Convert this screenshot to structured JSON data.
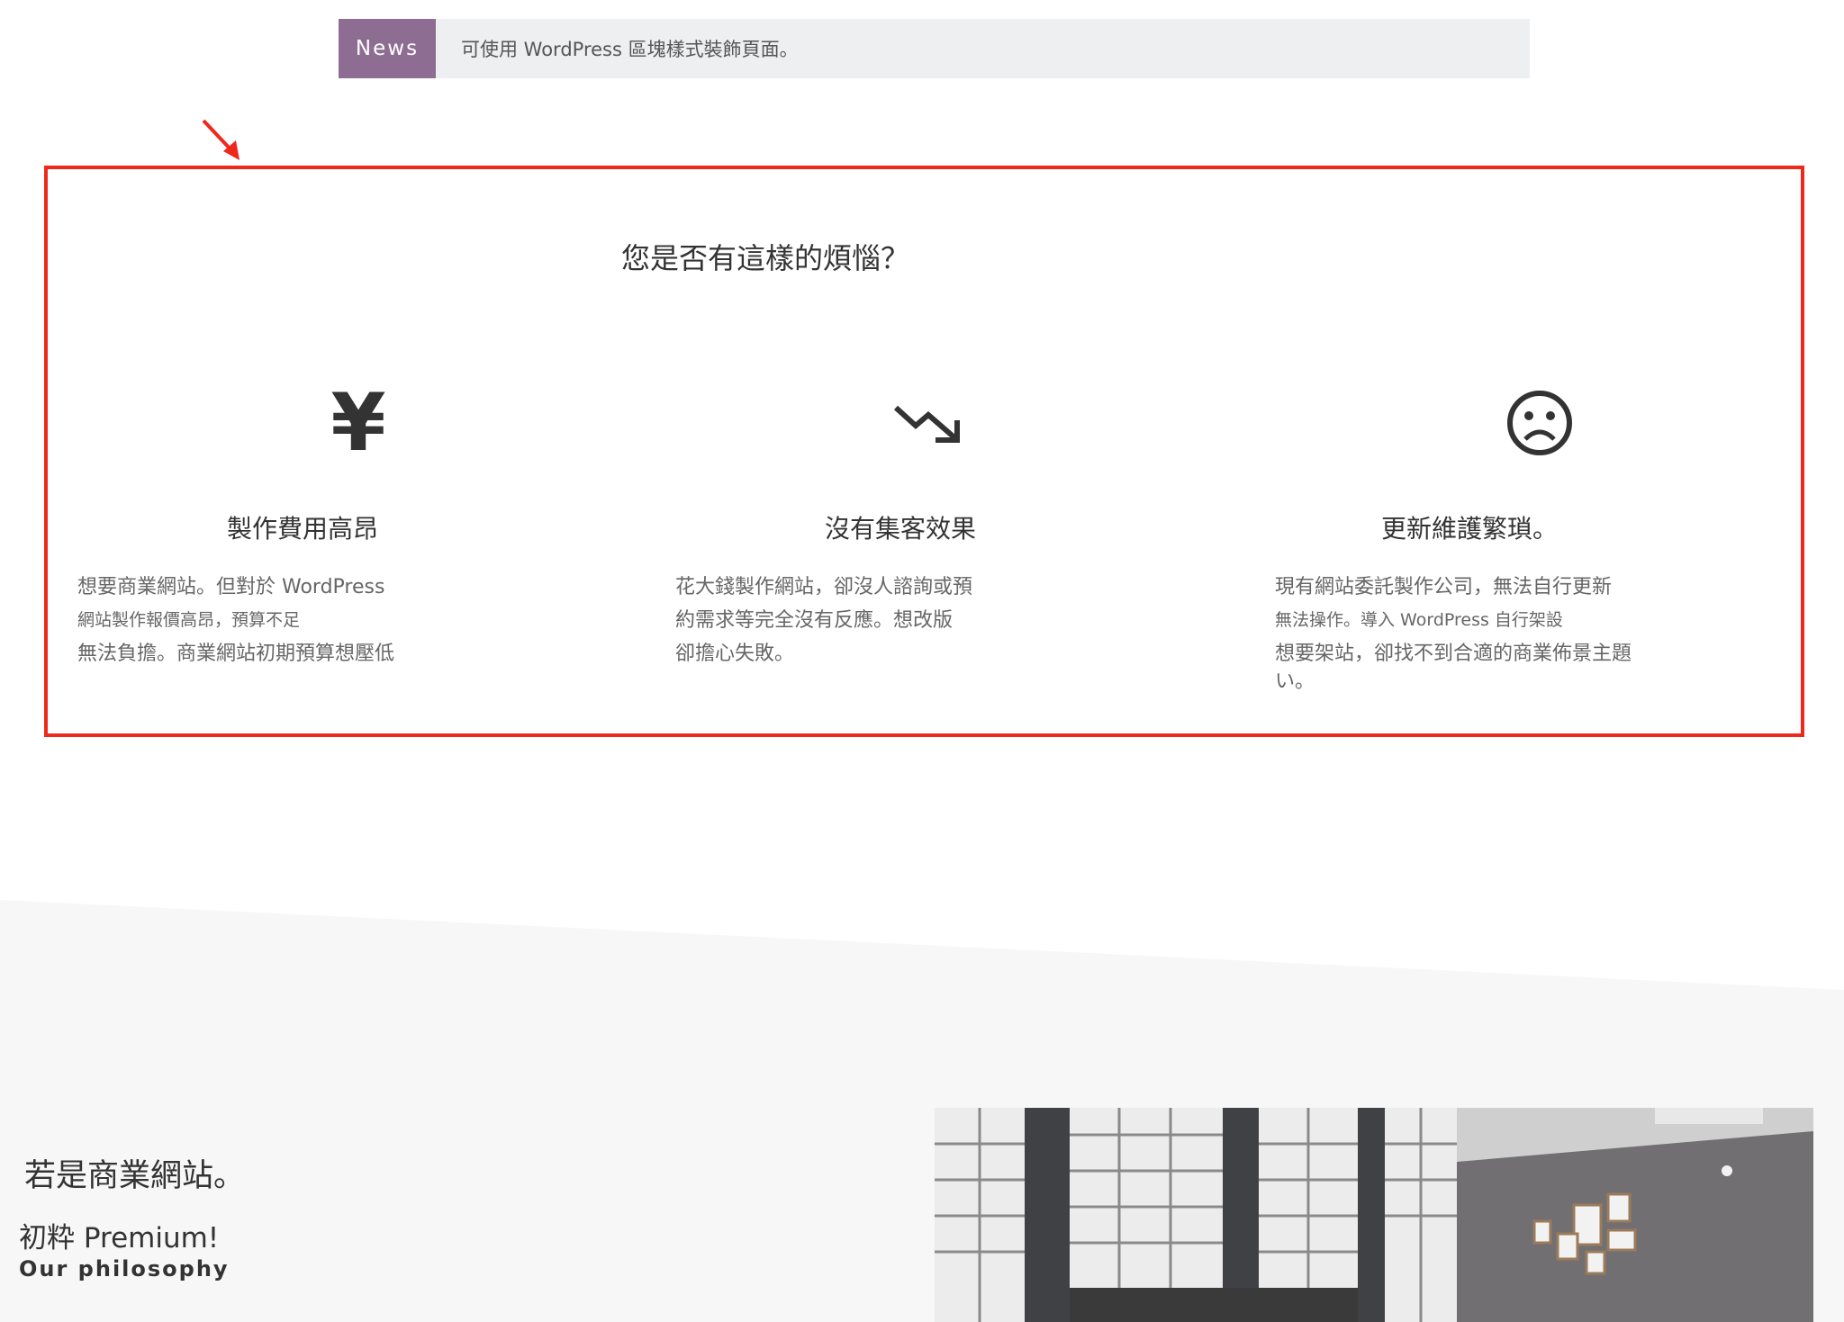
{
  "news": {
    "tag": "News",
    "text": "可使用 WordPress 區塊樣式裝飾頁面。"
  },
  "worries": {
    "title": "您是否有這樣的煩惱？",
    "items": [
      {
        "icon": "yen-icon",
        "icon_glyph": "¥",
        "title": "製作費用高昂",
        "lines": [
          "想要商業網站。但對於 WordPress",
          "網站製作報價高昂，預算不足",
          "無法負擔。商業網站初期預算想壓低"
        ]
      },
      {
        "icon": "trend-down-icon",
        "title": "沒有集客效果",
        "lines": [
          "花大錢製作網站，卻沒人諮詢或預",
          "約需求等完全沒有反應。想改版",
          "卻擔心失敗。"
        ]
      },
      {
        "icon": "sad-face-icon",
        "icon_glyph": "☹",
        "title": "更新維護繁瑣。",
        "lines": [
          "現有網站委託製作公司，無法自行更新",
          "無法操作。導入 WordPress 自行架設",
          "想要架站，卻找不到合適的商業佈景主題",
          "い。"
        ]
      }
    ]
  },
  "business": {
    "heading": "若是商業網站。",
    "subheading": "初粋 Premium!",
    "philosophy": "Our philosophy"
  },
  "colors": {
    "news_tag": "#8e6d92",
    "annotation": "#f0281c",
    "gray_band": "#f7f7f7"
  }
}
